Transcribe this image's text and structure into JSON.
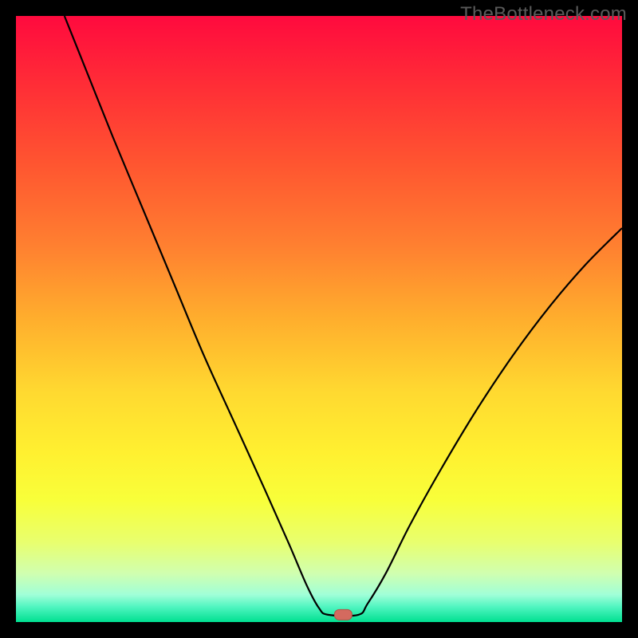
{
  "watermark": "TheBottleneck.com",
  "colors": {
    "black": "#000000",
    "curve": "#000000",
    "marker_fill": "#d46a5f",
    "marker_stroke": "#b65248"
  },
  "gradient": {
    "stops": [
      {
        "offset": 0.0,
        "color": "#ff0a3e"
      },
      {
        "offset": 0.12,
        "color": "#ff2f36"
      },
      {
        "offset": 0.25,
        "color": "#ff5730"
      },
      {
        "offset": 0.38,
        "color": "#ff8030"
      },
      {
        "offset": 0.5,
        "color": "#ffae2d"
      },
      {
        "offset": 0.62,
        "color": "#ffd930"
      },
      {
        "offset": 0.72,
        "color": "#fff030"
      },
      {
        "offset": 0.8,
        "color": "#f8ff3a"
      },
      {
        "offset": 0.87,
        "color": "#e8ff70"
      },
      {
        "offset": 0.92,
        "color": "#d0ffb0"
      },
      {
        "offset": 0.955,
        "color": "#a0ffd8"
      },
      {
        "offset": 0.975,
        "color": "#50f5c0"
      },
      {
        "offset": 1.0,
        "color": "#00e090"
      }
    ]
  },
  "chart_data": {
    "type": "line",
    "title": "",
    "xlabel": "",
    "ylabel": "",
    "xlim": [
      0,
      100
    ],
    "ylim": [
      0,
      100
    ],
    "marker": {
      "x": 54,
      "y": 1.2
    },
    "series": [
      {
        "name": "bottleneck-curve",
        "points": [
          {
            "x": 8,
            "y": 100
          },
          {
            "x": 12,
            "y": 90
          },
          {
            "x": 16,
            "y": 80
          },
          {
            "x": 21,
            "y": 68
          },
          {
            "x": 26,
            "y": 56
          },
          {
            "x": 31,
            "y": 44
          },
          {
            "x": 36,
            "y": 33
          },
          {
            "x": 41,
            "y": 22
          },
          {
            "x": 45,
            "y": 13
          },
          {
            "x": 48,
            "y": 6
          },
          {
            "x": 50,
            "y": 2.3
          },
          {
            "x": 51.5,
            "y": 1.2
          },
          {
            "x": 56.5,
            "y": 1.2
          },
          {
            "x": 58,
            "y": 3
          },
          {
            "x": 61,
            "y": 8
          },
          {
            "x": 65,
            "y": 16
          },
          {
            "x": 70,
            "y": 25
          },
          {
            "x": 76,
            "y": 35
          },
          {
            "x": 82,
            "y": 44
          },
          {
            "x": 88,
            "y": 52
          },
          {
            "x": 94,
            "y": 59
          },
          {
            "x": 100,
            "y": 65
          }
        ]
      }
    ]
  }
}
